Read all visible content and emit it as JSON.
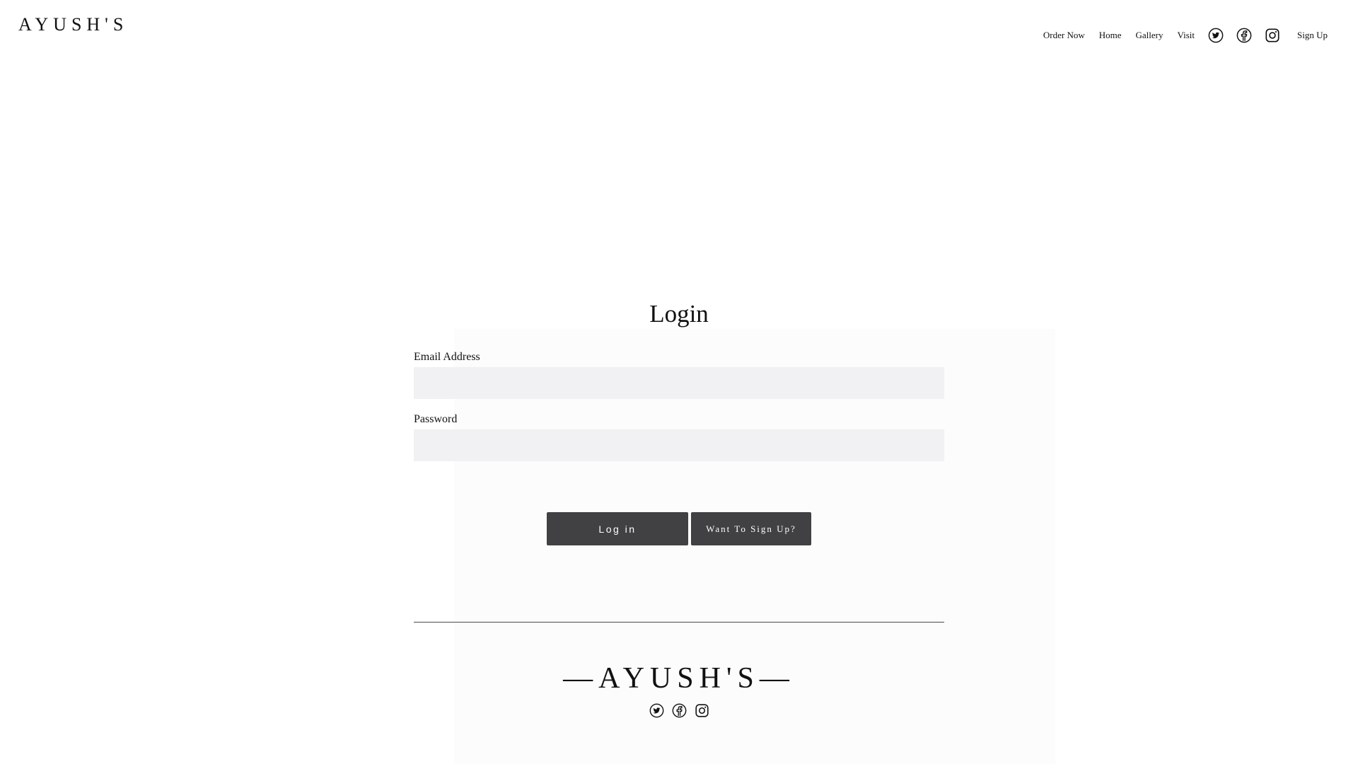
{
  "header": {
    "brand": "AYUSH'S",
    "nav": {
      "order_now": "Order Now",
      "home": "Home",
      "gallery": "Gallery",
      "visit": "Visit",
      "sign_up": "Sign Up"
    },
    "social_icons": [
      "twitter-icon",
      "facebook-icon",
      "instagram-icon"
    ]
  },
  "login": {
    "title": "Login",
    "email_label": "Email Address",
    "email_value": "",
    "password_label": "Password",
    "password_value": "",
    "login_button": "Log in",
    "signup_button": "Want To Sign Up?"
  },
  "footer": {
    "brand": "—AYUSH'S—",
    "social_icons": [
      "twitter-icon",
      "facebook-icon",
      "instagram-icon"
    ]
  },
  "colors": {
    "button_bg": "#414042",
    "input_bg": "#f1f0f2",
    "text": "#111111"
  }
}
